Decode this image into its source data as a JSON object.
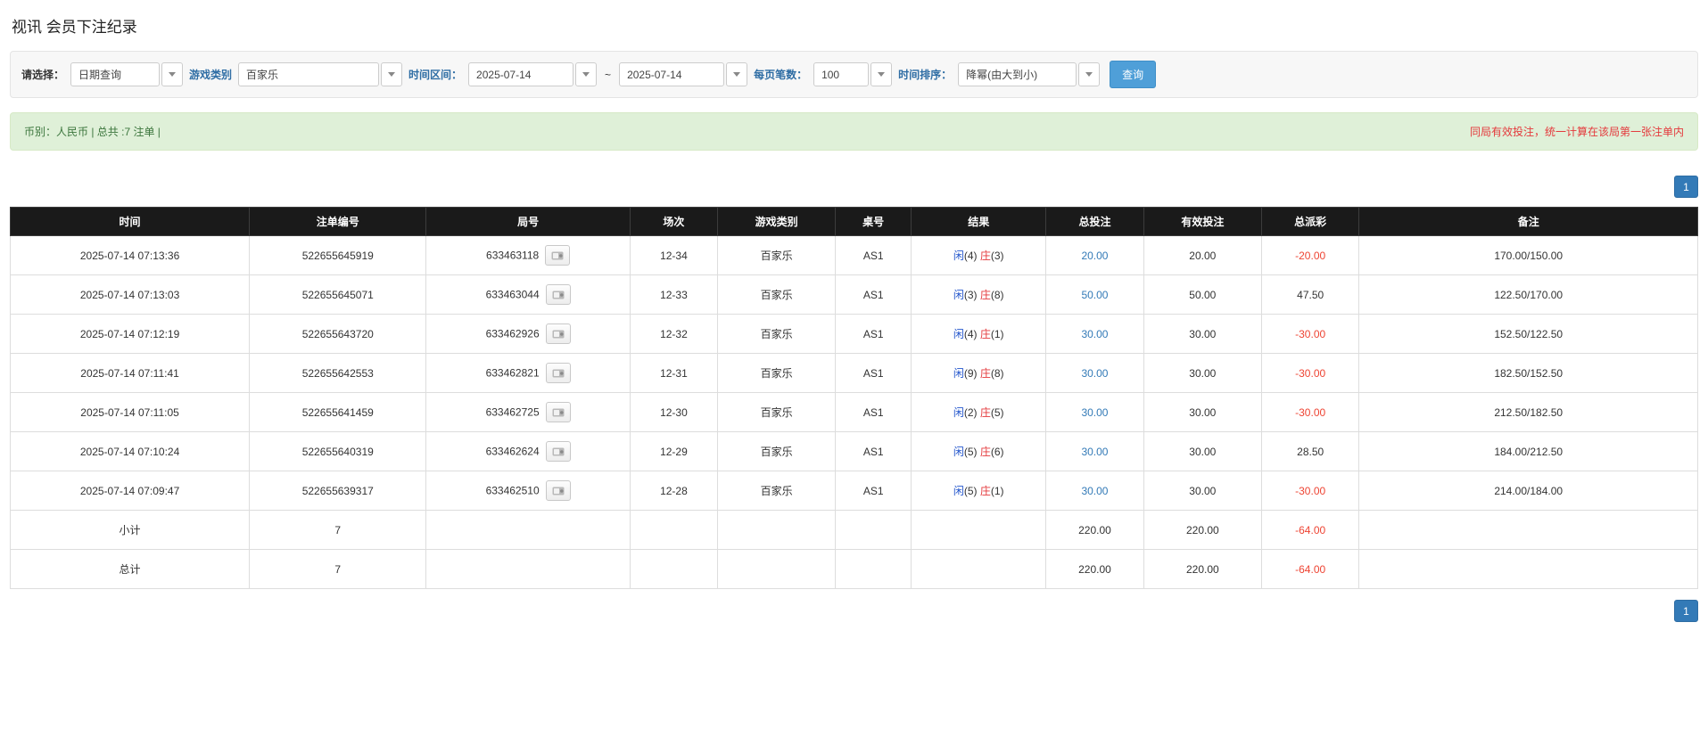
{
  "page": {
    "title": "视讯 会员下注纪录"
  },
  "filters": {
    "select_label": "请选择：",
    "select_value": "日期查询",
    "game_type_label": "游戏类别",
    "game_type_value": "百家乐",
    "date_range_label": "时间区间：",
    "date_from": "2025-07-14",
    "tilde": "~",
    "date_to": "2025-07-14",
    "page_size_label": "每页笔数：",
    "page_size_value": "100",
    "sort_label": "时间排序：",
    "sort_value": "降幂(由大到小)",
    "search_button": "查询"
  },
  "info_bar": {
    "left": "币别：人民币 | 总共 :7 注单 |",
    "right": "同局有效投注，统一计算在该局第一张注单内"
  },
  "pagination": {
    "page": "1"
  },
  "table": {
    "headers": [
      "时间",
      "注单编号",
      "局号",
      "场次",
      "游戏类别",
      "桌号",
      "结果",
      "总投注",
      "有效投注",
      "总派彩",
      "备注"
    ],
    "rows": [
      {
        "time": "2025-07-14 07:13:36",
        "bet_id": "522655645919",
        "round_id": "633463118",
        "session": "12-34",
        "game": "百家乐",
        "table_no": "AS1",
        "player_label": "闲",
        "player_num": "(4)",
        "banker_label": "庄",
        "banker_num": "(3)",
        "total_bet": "20.00",
        "valid_bet": "20.00",
        "payout": "-20.00",
        "note": "170.00/150.00"
      },
      {
        "time": "2025-07-14 07:13:03",
        "bet_id": "522655645071",
        "round_id": "633463044",
        "session": "12-33",
        "game": "百家乐",
        "table_no": "AS1",
        "player_label": "闲",
        "player_num": "(3)",
        "banker_label": "庄",
        "banker_num": "(8)",
        "total_bet": "50.00",
        "valid_bet": "50.00",
        "payout": "47.50",
        "note": "122.50/170.00"
      },
      {
        "time": "2025-07-14 07:12:19",
        "bet_id": "522655643720",
        "round_id": "633462926",
        "session": "12-32",
        "game": "百家乐",
        "table_no": "AS1",
        "player_label": "闲",
        "player_num": "(4)",
        "banker_label": "庄",
        "banker_num": "(1)",
        "total_bet": "30.00",
        "valid_bet": "30.00",
        "payout": "-30.00",
        "note": "152.50/122.50"
      },
      {
        "time": "2025-07-14 07:11:41",
        "bet_id": "522655642553",
        "round_id": "633462821",
        "session": "12-31",
        "game": "百家乐",
        "table_no": "AS1",
        "player_label": "闲",
        "player_num": "(9)",
        "banker_label": "庄",
        "banker_num": "(8)",
        "total_bet": "30.00",
        "valid_bet": "30.00",
        "payout": "-30.00",
        "note": "182.50/152.50"
      },
      {
        "time": "2025-07-14 07:11:05",
        "bet_id": "522655641459",
        "round_id": "633462725",
        "session": "12-30",
        "game": "百家乐",
        "table_no": "AS1",
        "player_label": "闲",
        "player_num": "(2)",
        "banker_label": "庄",
        "banker_num": "(5)",
        "total_bet": "30.00",
        "valid_bet": "30.00",
        "payout": "-30.00",
        "note": "212.50/182.50"
      },
      {
        "time": "2025-07-14 07:10:24",
        "bet_id": "522655640319",
        "round_id": "633462624",
        "session": "12-29",
        "game": "百家乐",
        "table_no": "AS1",
        "player_label": "闲",
        "player_num": "(5)",
        "banker_label": "庄",
        "banker_num": "(6)",
        "total_bet": "30.00",
        "valid_bet": "30.00",
        "payout": "28.50",
        "note": "184.00/212.50"
      },
      {
        "time": "2025-07-14 07:09:47",
        "bet_id": "522655639317",
        "round_id": "633462510",
        "session": "12-28",
        "game": "百家乐",
        "table_no": "AS1",
        "player_label": "闲",
        "player_num": "(5)",
        "banker_label": "庄",
        "banker_num": "(1)",
        "total_bet": "30.00",
        "valid_bet": "30.00",
        "payout": "-30.00",
        "note": "214.00/184.00"
      }
    ],
    "subtotal": {
      "label": "小计",
      "count": "7",
      "total_bet": "220.00",
      "valid_bet": "220.00",
      "payout": "-64.00"
    },
    "total": {
      "label": "总计",
      "count": "7",
      "total_bet": "220.00",
      "valid_bet": "220.00",
      "payout": "-64.00"
    }
  }
}
